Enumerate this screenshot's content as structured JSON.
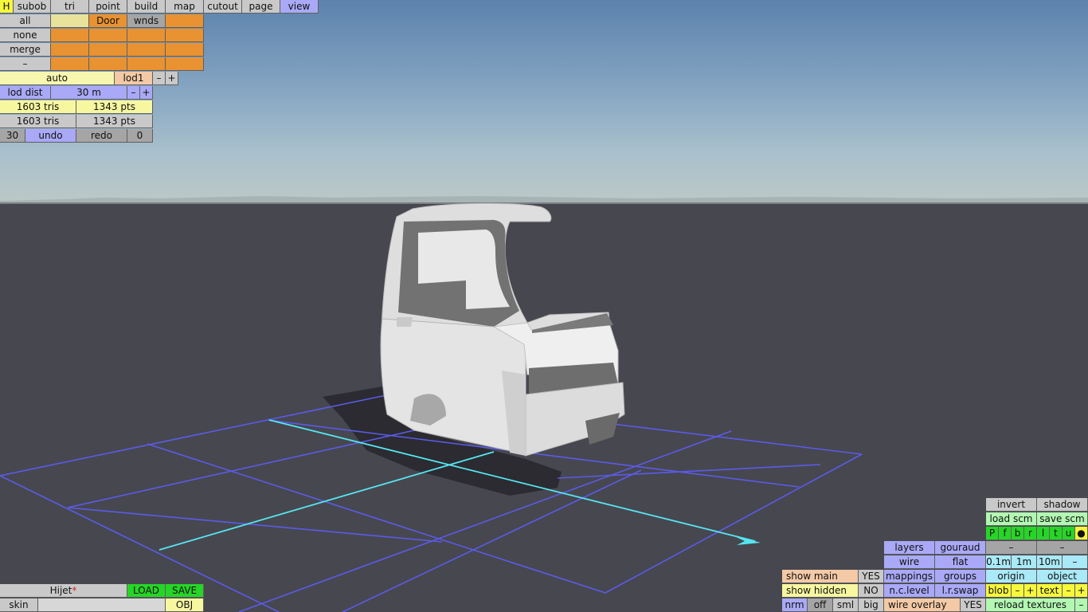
{
  "top_tabs": [
    "H",
    "subob",
    "tri",
    "point",
    "build",
    "map",
    "cutout",
    "page",
    "view"
  ],
  "sel_rows": {
    "all": "all",
    "none": "none",
    "merge": "merge",
    "minus": "–"
  },
  "subobj": {
    "door": "Door",
    "wnds": "wnds"
  },
  "lod": {
    "auto": "auto",
    "lod1": "lod1",
    "minus": "–",
    "plus": "+",
    "dist_label": "lod dist",
    "dist_value": "30 m"
  },
  "stats": {
    "tris1": "1603 tris",
    "pts1": "1343 pts",
    "tris2": "1603 tris",
    "pts2": "1343 pts"
  },
  "undo_bar": {
    "count": "30",
    "undo": "undo",
    "redo": "redo",
    "redo_count": "0"
  },
  "file": {
    "name": "Hijet",
    "modified_mark": "*",
    "load": "LOAD",
    "save": "SAVE",
    "skin": "skin",
    "obj": "OBJ"
  },
  "right": {
    "invert": "invert",
    "shadow": "shadow",
    "load_scm": "load scm",
    "save_scm": "save scm",
    "views": [
      "P",
      "f",
      "b",
      "r",
      "l",
      "t",
      "u",
      "●"
    ],
    "layers": "layers",
    "gouraud": "gouraud",
    "minus1": "–",
    "minus2": "–",
    "wire": "wire",
    "flat": "flat",
    "s01": "0.1m",
    "s1": "1m",
    "s10": "10m",
    "sminus": "–",
    "show_main": "show main",
    "yes1": "YES",
    "mappings": "mappings",
    "groups": "groups",
    "origin": "origin",
    "object": "object",
    "show_hidden": "show hidden",
    "no": "NO",
    "nclevel": "n.c.level",
    "lrswap": "l.r.swap",
    "blob": "blob",
    "bminus": "–",
    "bplus": "+",
    "text": "text",
    "tminus": "–",
    "tplus": "+",
    "nrm": "nrm",
    "off": "off",
    "sml": "sml",
    "big": "big",
    "wire_overlay": "wire overlay",
    "yes2": "YES",
    "reload": "reload textures",
    "rminus": "–"
  },
  "colors": {
    "sky_top": "#5c82ad",
    "ground": "#474750",
    "grid": "#5b5be8",
    "axis": "#56e6f0",
    "model": "#e6e6e6"
  }
}
